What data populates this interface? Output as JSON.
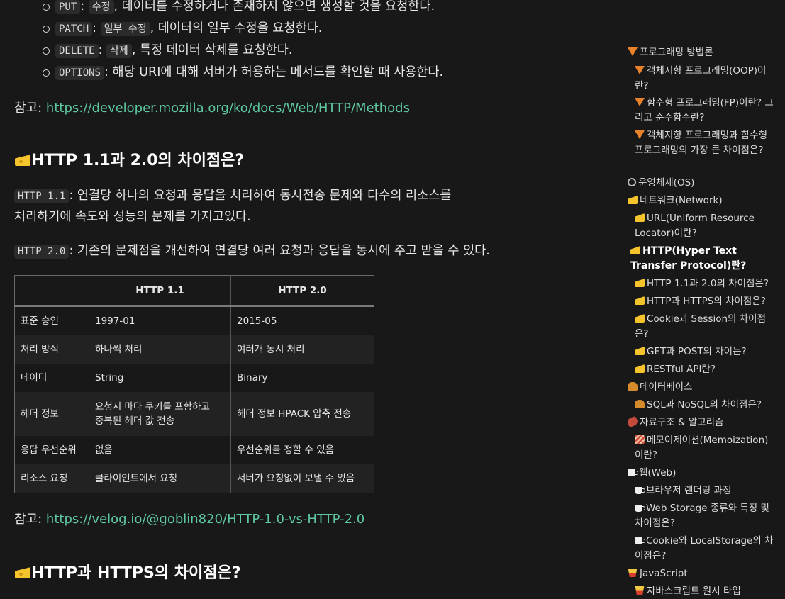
{
  "methods": [
    {
      "code": "PUT",
      "ko": "수정",
      "desc": ", 데이터를 수정하거나 존재하지 않으면 생성할 것을 요청한다."
    },
    {
      "code": "PATCH",
      "ko": "일부 수정",
      "desc": ", 데이터의 일부 수정을 요청한다."
    },
    {
      "code": "DELETE",
      "ko": "삭제",
      "desc": ", 특정 데이터 삭제를 요청한다."
    },
    {
      "code": "OPTIONS",
      "ko": "",
      "desc": ": 해당 URI에 대해 서버가 허용하는 메서드를 확인할 때 사용한다."
    }
  ],
  "ref1": {
    "label": "참고:",
    "url": "https://developer.mozilla.org/ko/docs/Web/HTTP/Methods"
  },
  "section1": {
    "title": "HTTP 1.1과 2.0의 차이점은?"
  },
  "para1": {
    "code": "HTTP 1.1",
    "line1": ": 연결당 하나의 요청과 응답을 처리하여 동시전송 문제와 다수의 리소스를",
    "line2": "처리하기에 속도와 성능의 문제를 가지고있다."
  },
  "para2": {
    "code": "HTTP 2.0",
    "line1": ": 기존의 문제점을 개선하여 연결당 여러 요청과 응답을 동시에 주고 받을 수 있다."
  },
  "table": {
    "headers": [
      "",
      "HTTP 1.1",
      "HTTP 2.0"
    ],
    "rows": [
      [
        "표준 승인",
        "1997-01",
        "2015-05"
      ],
      [
        "처리 방식",
        "하나씩 처리",
        "여러개 동시 처리"
      ],
      [
        "데이터",
        "String",
        "Binary"
      ],
      [
        "헤더 정보",
        "요청시 마다 쿠키를 포함하고 중복된 헤더 값 전송",
        "헤더 정보 HPACK 압축 전송"
      ],
      [
        "응답 우선순위",
        "없음",
        "우선순위를 정할 수 있음"
      ],
      [
        "리소스 요청",
        "클라이언트에서 요청",
        "서버가 요청없이 보낼 수 있음"
      ]
    ],
    "row4_col1_line1": "요청시 마다 쿠키를 포함하고",
    "row4_col1_line2": "중복된 헤더 값 전송"
  },
  "ref2": {
    "label": "참고:",
    "url": "https://velog.io/@goblin820/HTTP-1.0-vs-HTTP-2.0"
  },
  "section2": {
    "title": "HTTP과 HTTPS의 차이점은?"
  },
  "toc": [
    {
      "icon": "pizza-icon",
      "text": "프로그래밍 방법론"
    },
    {
      "icon": "pizza-icon",
      "text": "객체지향 프로그래밍(OOP)이란?"
    },
    {
      "icon": "pizza-icon",
      "text": "함수형 프로그래밍(FP)이란? 그리고 순수함수란?"
    },
    {
      "icon": "pizza-icon",
      "text": "객체지향 프로그래밍과 함수형 프로그래밍의 가장 큰 차이점은?"
    },
    {
      "icon": "magnifier-icon",
      "text": "운영체제(OS)"
    },
    {
      "icon": "cheese-icon",
      "text": "네트워크(Network)"
    },
    {
      "icon": "cheese-icon",
      "text": "URL(Uniform Resource Locator)이란?"
    },
    {
      "icon": "cheese-icon",
      "text": "HTTP(Hyper Text Transfer Protocol)란?"
    },
    {
      "icon": "cheese-icon",
      "text": "HTTP 1.1과 2.0의 차이점은?"
    },
    {
      "icon": "cheese-icon",
      "text": "HTTP과 HTTPS의 차이점은?"
    },
    {
      "icon": "cheese-icon",
      "text": "Cookie과 Session의 차이점은?"
    },
    {
      "icon": "cheese-icon",
      "text": "GET과 POST의 차이는?"
    },
    {
      "icon": "cheese-icon",
      "text": "RESTful API란?"
    },
    {
      "icon": "burger-icon",
      "text": "데이터베이스"
    },
    {
      "icon": "burger-icon",
      "text": "SQL과 NoSQL의 차이점은?"
    },
    {
      "icon": "meat-icon",
      "text": "자료구조 & 알고리즘"
    },
    {
      "icon": "bacon-icon",
      "text": "메모이제이션(Memoization)이란?"
    },
    {
      "icon": "coffee-icon",
      "text": "웹(Web)"
    },
    {
      "icon": "coffee-icon",
      "text": "브라우저 렌더링 과정"
    },
    {
      "icon": "coffee-icon",
      "text": "Web Storage 종류와 특징 및 차이점은?"
    },
    {
      "icon": "coffee-icon",
      "text": "Cookie와 LocalStorage의 차이점은?"
    },
    {
      "icon": "fries-icon",
      "text": "JavaScript"
    },
    {
      "icon": "fries-icon",
      "text": "자바스크립트 원시 타입"
    }
  ]
}
